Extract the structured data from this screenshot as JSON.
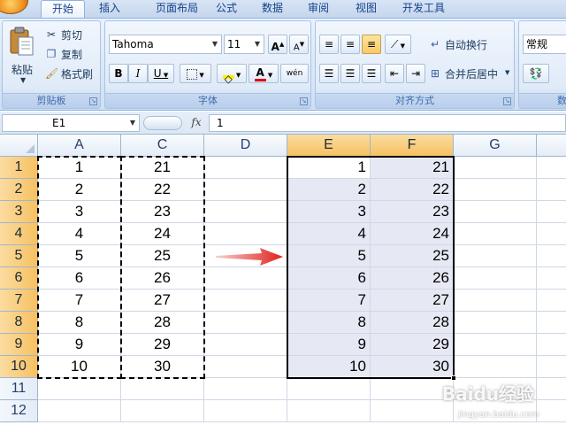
{
  "tabs": [
    "开始",
    "插入",
    "页面布局",
    "公式",
    "数据",
    "审阅",
    "视图",
    "开发工具"
  ],
  "active_tab": "开始",
  "clipboard": {
    "paste_label": "粘贴",
    "cut_label": "剪切",
    "copy_label": "复制",
    "format_painter_label": "格式刷",
    "group_label": "剪贴板"
  },
  "font": {
    "font_name": "Tahoma",
    "font_size": "11",
    "bold_label": "B",
    "italic_label": "I",
    "underline_label": "U",
    "grow_label": "A",
    "shrink_label": "A",
    "font_color_label": "A",
    "phonetic_label": "wén",
    "group_label": "字体"
  },
  "alignment": {
    "wrap_text_label": "自动换行",
    "merge_center_label": "合并后居中",
    "group_label": "对齐方式"
  },
  "number": {
    "format_value": "常规"
  },
  "formula_bar": {
    "name_box": "E1",
    "fx_label": "fx",
    "formula": "1"
  },
  "columns": [
    "A",
    "C",
    "D",
    "E",
    "F",
    "G"
  ],
  "selected_columns": [
    "E",
    "F"
  ],
  "rows": [
    "1",
    "2",
    "3",
    "4",
    "5",
    "6",
    "7",
    "8",
    "9",
    "10",
    "11",
    "12"
  ],
  "selected_rows": [
    "1",
    "2",
    "3",
    "4",
    "5",
    "6",
    "7",
    "8",
    "9",
    "10"
  ],
  "col_A": [
    "1",
    "2",
    "3",
    "4",
    "5",
    "6",
    "7",
    "8",
    "9",
    "10"
  ],
  "col_C": [
    "21",
    "22",
    "23",
    "24",
    "25",
    "26",
    "27",
    "28",
    "29",
    "30"
  ],
  "col_E": [
    "1",
    "2",
    "3",
    "4",
    "5",
    "6",
    "7",
    "8",
    "9",
    "10"
  ],
  "col_F": [
    "21",
    "22",
    "23",
    "24",
    "25",
    "26",
    "27",
    "28",
    "29",
    "30"
  ],
  "watermark": {
    "brand": "Baidu经验",
    "url": "jingyan.baidu.com"
  },
  "colors": {
    "selection_tint": "#e6e9f3",
    "header_selected": "#f6c162",
    "arrow": "#e0201c"
  }
}
